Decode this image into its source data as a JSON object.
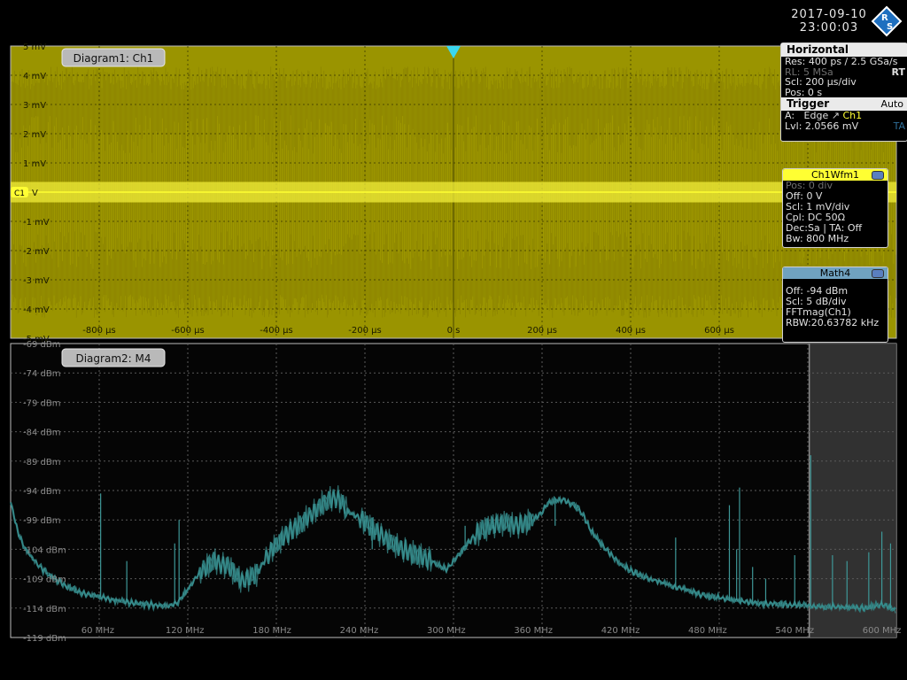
{
  "datetime": {
    "date": "2017-09-10",
    "time": "23:00:03"
  },
  "logo": {
    "letters": "RS"
  },
  "colors": {
    "ch1": "#ffff33",
    "ch1_bg": "#9a9400",
    "math": "#2e7f7f",
    "math_header": "#70a2c0",
    "background": "#000000"
  },
  "horizontal": {
    "title": "Horizontal",
    "res": "Res: 400 ps / 2.5 GSa/s",
    "rl": "RL:  5 MSa",
    "rt": "RT",
    "scl": "Scl:  200 μs/div",
    "pos": "Pos: 0 s"
  },
  "trigger": {
    "title": "Trigger",
    "mode": "Auto",
    "a_label": "A:",
    "type": "Edge",
    "edge_icon": "rising-edge-icon",
    "source": "Ch1",
    "lvl": "Lvl:   2.0566 mV",
    "ta": "TA"
  },
  "ch1_panel": {
    "title": "Ch1Wfm1",
    "pos": "Pos: 0 div",
    "off": "Off:  0 V",
    "scl": "Scl:  1 mV/div",
    "cpl": "Cpl: DC 50Ω",
    "dec": "Dec:Sa | TA: Off",
    "bw": "Bw:  800 MHz"
  },
  "math_panel": {
    "title": "Math4",
    "off": "Off:   -94 dBm",
    "scl": "Scl:   5 dB/div",
    "func": "FFTmag(Ch1)",
    "rbw": "RBW:20.63782 kHz"
  },
  "diagram1": {
    "label": "Diagram1: Ch1",
    "marker": "C1",
    "marker_suffix": "V"
  },
  "diagram2": {
    "label": "Diagram2: M4"
  },
  "chart_data": [
    {
      "type": "area",
      "series": [
        {
          "name": "Ch1",
          "y_center": 0,
          "noise_envelope": [
            -4.3,
            4.3
          ],
          "dense_band": [
            -2.2,
            2.2
          ]
        }
      ],
      "title": "Diagram1: Ch1",
      "x_ticks": [
        "-800 μs",
        "-600 μs",
        "-400 μs",
        "-200 μs",
        "0 s",
        "200 μs",
        "400 μs",
        "600 μs"
      ],
      "x_tick_values": [
        -800,
        -600,
        -400,
        -200,
        0,
        200,
        400,
        600
      ],
      "y_ticks": [
        "5 mV",
        "4 mV",
        "3 mV",
        "2 mV",
        "1 mV",
        "-1 mV",
        "-2 mV",
        "-3 mV",
        "-4 mV",
        "-5 mV"
      ],
      "y_tick_values": [
        5,
        4,
        3,
        2,
        1,
        -1,
        -2,
        -3,
        -4,
        -5
      ],
      "xlim": [
        -1000,
        1000
      ],
      "ylim": [
        -5,
        5
      ],
      "grid": true
    },
    {
      "type": "line",
      "series": [
        {
          "name": "M4",
          "x": [
            0,
            5,
            10,
            20,
            30,
            40,
            50,
            60,
            70,
            80,
            90,
            100,
            110,
            115,
            120,
            130,
            140,
            150,
            160,
            170,
            180,
            190,
            200,
            210,
            215,
            220,
            225,
            228,
            232,
            240,
            250,
            260,
            270,
            280,
            290,
            300,
            310,
            320,
            330,
            340,
            350,
            360,
            365,
            370,
            380,
            390,
            395,
            400,
            410,
            420,
            430,
            440,
            450,
            460,
            470,
            480,
            490,
            500,
            510,
            520,
            530,
            540,
            550,
            560,
            570,
            580,
            590,
            600,
            610
          ],
          "y": [
            -96,
            -101,
            -104,
            -107,
            -109,
            -110.5,
            -111.5,
            -112,
            -112.6,
            -113,
            -113.3,
            -113.5,
            -113.6,
            -113,
            -111.5,
            -108,
            -106,
            -107,
            -109.5,
            -108,
            -104,
            -101.5,
            -99.5,
            -97.5,
            -96.2,
            -95.5,
            -95.2,
            -96,
            -97.5,
            -98.5,
            -100.5,
            -102.5,
            -104,
            -105,
            -106,
            -107.5,
            -104.5,
            -101.5,
            -100,
            -99.5,
            -100,
            -99,
            -98,
            -96,
            -95.5,
            -96.8,
            -98.5,
            -101,
            -104,
            -106.5,
            -108,
            -109,
            -109.8,
            -110.5,
            -111.3,
            -112,
            -112.3,
            -112.7,
            -113,
            -113.2,
            -113.3,
            -113.5,
            -113.6,
            -113.8,
            -113.8,
            -113.9,
            -114,
            -113.3,
            -114.5
          ],
          "ripple_ranges_mhz": [
            [
              130,
              150
            ],
            [
              150,
              170
            ],
            [
              175,
              232
            ],
            [
              240,
              290
            ],
            [
              320,
              360
            ]
          ],
          "spurs": [
            {
              "x": 62,
              "peak": -94.5
            },
            {
              "x": 80,
              "peak": -106
            },
            {
              "x": 113,
              "peak": -103
            },
            {
              "x": 116,
              "peak": -99
            },
            {
              "x": 249,
              "peak": -104
            },
            {
              "x": 313,
              "peak": -100
            },
            {
              "x": 332,
              "peak": -100.5
            },
            {
              "x": 375,
              "peak": -100
            },
            {
              "x": 458,
              "peak": -102
            },
            {
              "x": 495,
              "peak": -96.5
            },
            {
              "x": 500,
              "peak": -104
            },
            {
              "x": 502,
              "peak": -93.5
            },
            {
              "x": 511,
              "peak": -107
            },
            {
              "x": 520,
              "peak": -109
            },
            {
              "x": 540,
              "peak": -105
            },
            {
              "x": 551,
              "peak": -88
            },
            {
              "x": 566,
              "peak": -105
            },
            {
              "x": 576,
              "peak": -106
            },
            {
              "x": 591,
              "peak": -104.5
            },
            {
              "x": 600,
              "peak": -101
            },
            {
              "x": 606,
              "peak": -103
            }
          ]
        }
      ],
      "title": "Diagram2: M4",
      "x_ticks": [
        "60 MHz",
        "120 MHz",
        "180 MHz",
        "240 MHz",
        "300 MHz",
        "360 MHz",
        "420 MHz",
        "480 MHz",
        "540 MHz",
        "600 MHz"
      ],
      "x_tick_values": [
        60,
        120,
        180,
        240,
        300,
        360,
        420,
        480,
        540,
        600
      ],
      "y_ticks": [
        "-69 dBm",
        "-74 dBm",
        "-79 dBm",
        "-84 dBm",
        "-89 dBm",
        "-94 dBm",
        "-99 dBm",
        "-104 dBm",
        "-109 dBm",
        "-114 dBm",
        "-119 dBm"
      ],
      "y_tick_values": [
        -69,
        -74,
        -79,
        -84,
        -89,
        -94,
        -99,
        -104,
        -109,
        -114,
        -119
      ],
      "xlim": [
        0,
        610
      ],
      "ylim": [
        -119,
        -69
      ],
      "shaded_region_start_mhz": 550,
      "grid": true
    }
  ]
}
